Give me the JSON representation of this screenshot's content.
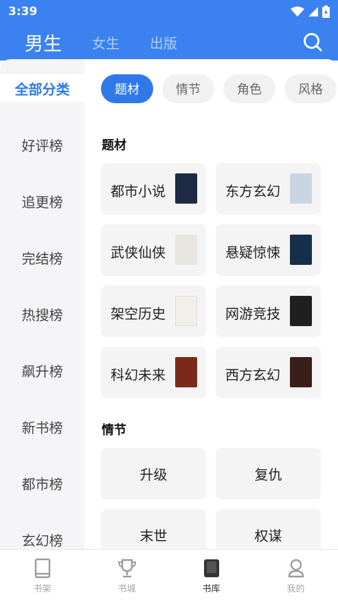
{
  "status_bar": {
    "time": "3:39"
  },
  "header": {
    "tabs": [
      {
        "label": "男生"
      },
      {
        "label": "女生"
      },
      {
        "label": "出版"
      }
    ]
  },
  "sidebar": {
    "items": [
      {
        "label": "全部分类"
      },
      {
        "label": "好评榜"
      },
      {
        "label": "追更榜"
      },
      {
        "label": "完结榜"
      },
      {
        "label": "热搜榜"
      },
      {
        "label": "飙升榜"
      },
      {
        "label": "新书榜"
      },
      {
        "label": "都市榜"
      },
      {
        "label": "玄幻榜"
      }
    ]
  },
  "chips": [
    {
      "label": "题材"
    },
    {
      "label": "情节"
    },
    {
      "label": "角色"
    },
    {
      "label": "风格"
    }
  ],
  "sections": {
    "theme": {
      "title": "题材",
      "items": [
        {
          "label": "都市小说",
          "cover_color": "#1d2b44"
        },
        {
          "label": "东方玄幻",
          "cover_color": "#c9d6e2"
        },
        {
          "label": "武侠仙侠",
          "cover_color": "#e8e6e0"
        },
        {
          "label": "悬疑惊悚",
          "cover_color": "#16304a"
        },
        {
          "label": "架空历史",
          "cover_color": "#f2efe8"
        },
        {
          "label": "网游竞技",
          "cover_color": "#1f1f1f"
        },
        {
          "label": "科幻未来",
          "cover_color": "#7a2a1a"
        },
        {
          "label": "西方玄幻",
          "cover_color": "#3a1e1a"
        }
      ]
    },
    "plot": {
      "title": "情节",
      "items": [
        {
          "label": "升级"
        },
        {
          "label": "复仇"
        },
        {
          "label": "末世"
        },
        {
          "label": "权谋"
        }
      ]
    }
  },
  "tabbar": {
    "items": [
      {
        "label": "书架",
        "icon": "bookshelf-icon"
      },
      {
        "label": "书城",
        "icon": "trophy-icon"
      },
      {
        "label": "书库",
        "icon": "library-icon"
      },
      {
        "label": "我的",
        "icon": "profile-icon"
      }
    ]
  },
  "colors": {
    "accent": "#3b82f0",
    "chip_active": "#2f7ae8",
    "sidebar_bg": "#f5f5f7",
    "card_bg": "#f4f4f4"
  }
}
